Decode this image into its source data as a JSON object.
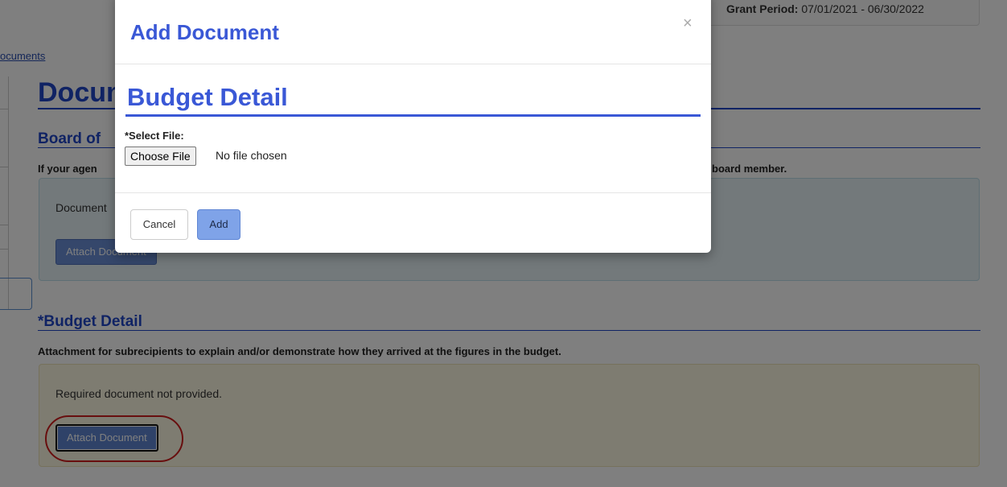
{
  "header": {
    "grant_label": "Grant Period:",
    "grant_value": "07/01/2021 - 06/30/2022",
    "breadcrumb": "ocuments"
  },
  "page": {
    "title": "Documents",
    "sections": [
      {
        "title": "Board of",
        "description_start": "If your agen",
        "description_end": "board member.",
        "status_text": "Document",
        "button_label": "Attach Document"
      },
      {
        "title": "*Budget Detail",
        "description": "Attachment for subrecipients to explain and/or demonstrate how they arrived at the figures in the budget.",
        "status_text": "Required document not provided.",
        "button_label": "Attach Document"
      }
    ]
  },
  "modal": {
    "title": "Add Document",
    "close_icon": "×",
    "heading": "Budget Detail",
    "file_label": "*Select File:",
    "file_button": "Choose File",
    "file_status": "No file chosen",
    "cancel_label": "Cancel",
    "add_label": "Add"
  },
  "colors": {
    "accent": "#2147c8",
    "modal_accent": "#3a58d6",
    "highlight_ring": "#d11c1c",
    "info_well": "#e6f2f7",
    "warning_well": "#fcf8e3"
  }
}
